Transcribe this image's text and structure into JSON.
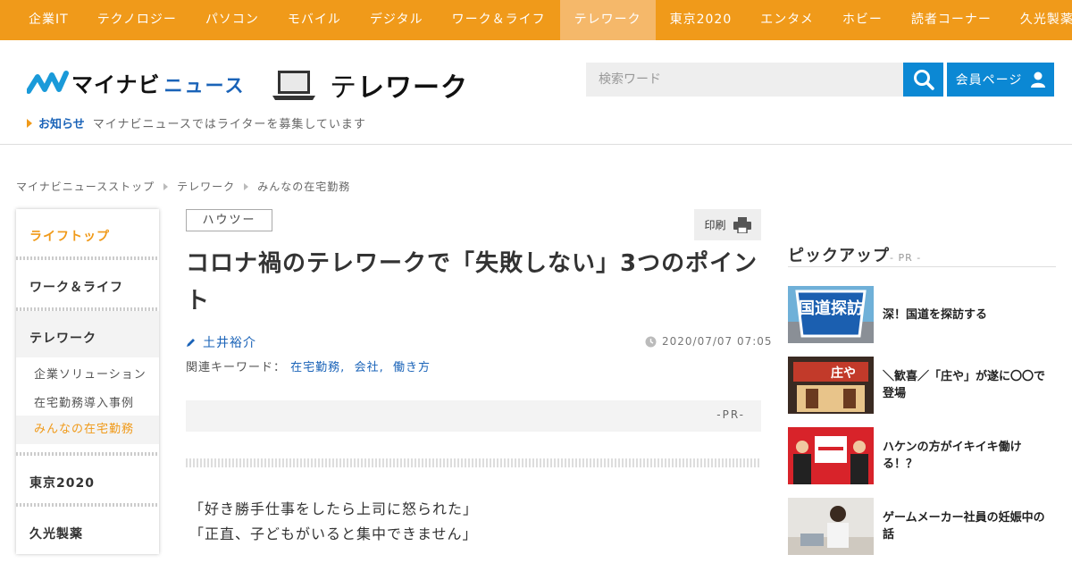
{
  "nav": {
    "items": [
      {
        "label": "企業IT"
      },
      {
        "label": "テクノロジー"
      },
      {
        "label": "パソコン"
      },
      {
        "label": "モバイル"
      },
      {
        "label": "デジタル"
      },
      {
        "label": "ワーク＆ライフ"
      },
      {
        "label": "テレワーク",
        "active": true
      },
      {
        "label": "東京2020"
      },
      {
        "label": "エンタメ"
      },
      {
        "label": "ホビー"
      },
      {
        "label": "読者コーナー"
      },
      {
        "label": "久光製薬"
      }
    ],
    "color": "#f09a1a",
    "active_color": "#f5b86a"
  },
  "header": {
    "logo_text": "マイナビ",
    "logo_sub": "ニュース",
    "section_title_a": "テ",
    "section_title_b": "レワーク",
    "search_placeholder": "検索ワード",
    "member_label": "会員ページ",
    "accent_color": "#0b88d4",
    "notice_label": "お知らせ",
    "notice_text": "マイナビニュースではライターを募集しています"
  },
  "breadcrumb": [
    "マイナビニュースストップ",
    "テレワーク",
    "みんなの在宅勤務"
  ],
  "sidebar": {
    "top_label": "ライフトップ",
    "items": [
      "ワーク＆ライフ",
      "テレワーク",
      "東京2020",
      "久光製薬"
    ],
    "subitems": [
      "企業ソリューション",
      "在宅勤務導入事例",
      "みんなの在宅勤務"
    ],
    "active_sub": "みんなの在宅勤務"
  },
  "article": {
    "tag": "ハウツー",
    "print_label": "印刷",
    "title": "コロナ禍のテレワークで「失敗しない」3つのポイント",
    "author": "土井裕介",
    "date": "2020/07/07 07:05",
    "keywords_label": "関連キーワード：",
    "keywords": [
      "在宅勤務,",
      "会社,",
      "働き方"
    ],
    "pr": "-PR-",
    "body": [
      "「好き勝手仕事をしたら上司に怒られた」",
      "「正直、子どもがいると集中できません」"
    ]
  },
  "pickup": {
    "title": "ピックアップ",
    "pr": "- PR -",
    "items": [
      {
        "text": "深！国道を探訪する",
        "thumb_text": "国道探訪"
      },
      {
        "text": "＼歓喜／「庄や」が遂に〇〇で登場",
        "thumb_text": "庄や"
      },
      {
        "text": "ハケンの方がイキイキ働ける！？",
        "thumb_text": ""
      },
      {
        "text": "ゲームメーカー社員の妊娠中の話",
        "thumb_text": ""
      }
    ]
  }
}
